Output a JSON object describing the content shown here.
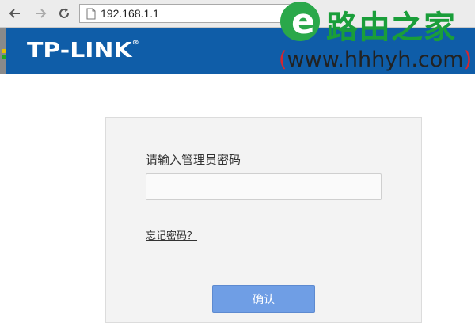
{
  "browser": {
    "url": "192.168.1.1"
  },
  "header": {
    "brand": "TP-LINK"
  },
  "watermark": {
    "title": "路由之家",
    "url_open": "(",
    "url_text": "www.hhhyh.com",
    "url_close": ")"
  },
  "login": {
    "password_label": "请输入管理员密码",
    "password_value": "",
    "forgot_link": "忘记密码？",
    "confirm_button": "确认"
  },
  "colors": {
    "brand_bar": "#0f5da8",
    "button": "#6f9ee5",
    "watermark_green": "#1a9e3a"
  }
}
